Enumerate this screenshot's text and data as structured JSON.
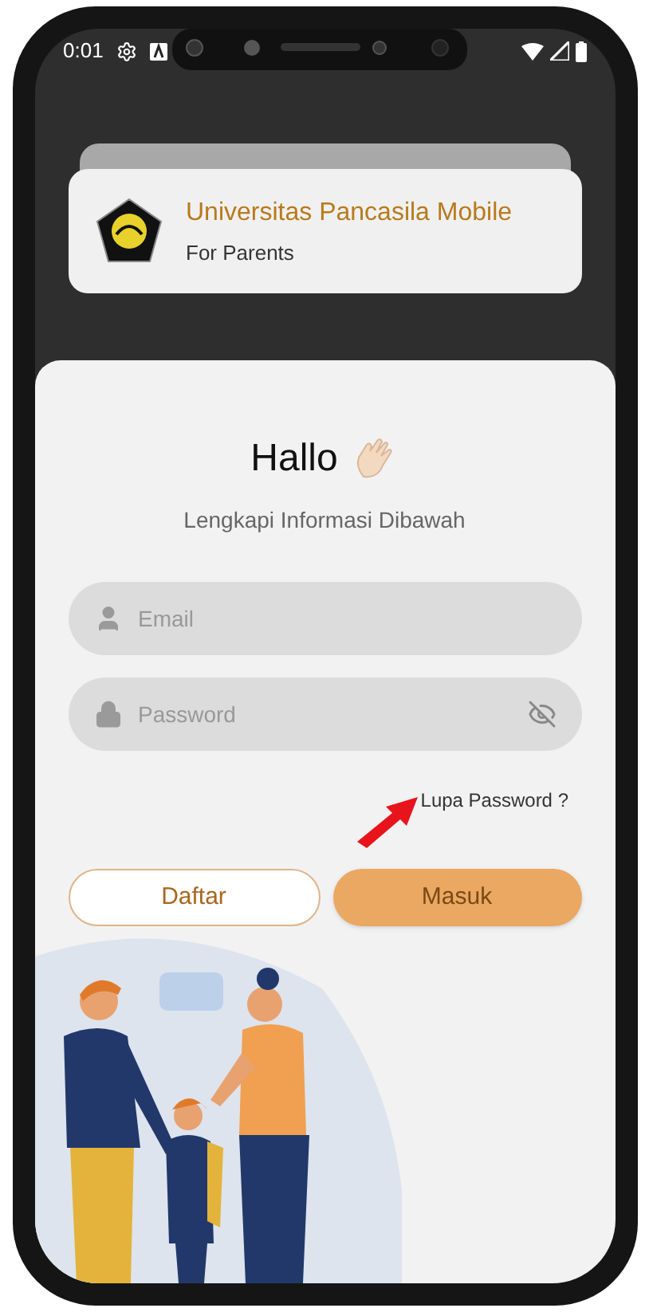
{
  "status_bar": {
    "time": "0:01"
  },
  "header": {
    "title": "Universitas Pancasila Mobile",
    "subtitle": "For Parents"
  },
  "greeting": {
    "title": "Hallo",
    "subtitle": "Lengkapi Informasi Dibawah"
  },
  "fields": [
    {
      "kind": "email",
      "placeholder": "Email"
    },
    {
      "kind": "password",
      "placeholder": "Password"
    }
  ],
  "forgot_link": "Lupa Password ?",
  "buttons": [
    {
      "kind": "outline",
      "label": "Daftar"
    },
    {
      "kind": "filled",
      "label": "Masuk"
    }
  ]
}
